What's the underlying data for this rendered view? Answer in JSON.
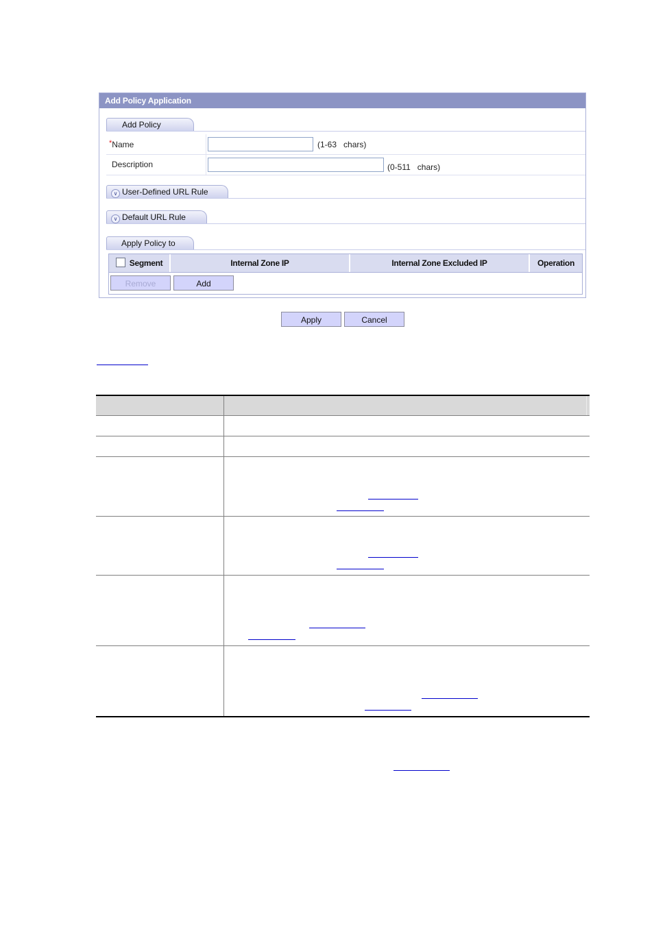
{
  "panel": {
    "title": "Add Policy Application",
    "sections": {
      "add_policy": "Add Policy",
      "user_defined_url_rule": "User-Defined URL Rule",
      "default_url_rule": "Default URL Rule",
      "apply_policy_to": "Apply Policy to"
    },
    "expand_icon": "double-chevron-down-icon",
    "fields": {
      "name": {
        "required_mark": "*",
        "label": "Name",
        "value": "",
        "placeholder": "",
        "hint": "(1-63   chars)"
      },
      "description": {
        "label": "Description",
        "value": "",
        "placeholder": "",
        "hint": "(0-511   chars)"
      }
    },
    "grid": {
      "columns": [
        "Segment",
        "Internal Zone IP",
        "Internal Zone Excluded IP",
        "Operation"
      ],
      "select_all_checked": false,
      "remove_label": "Remove",
      "remove_disabled": true,
      "add_label": "Add"
    },
    "apply_label": "Apply",
    "cancel_label": "Cancel"
  },
  "colors": {
    "title_bar": "#8c94c4",
    "button_fill": "#d3d4fb",
    "grid_header": "#d9dcf0",
    "link": "#0000cc",
    "doc_table_header": "#d9d9d9"
  },
  "doc_table": {
    "header": [
      "",
      ""
    ],
    "rows": [
      [
        "",
        ""
      ],
      [
        "",
        ""
      ],
      [
        "",
        ""
      ],
      [
        "",
        ""
      ],
      [
        "",
        ""
      ],
      [
        "",
        ""
      ]
    ]
  }
}
